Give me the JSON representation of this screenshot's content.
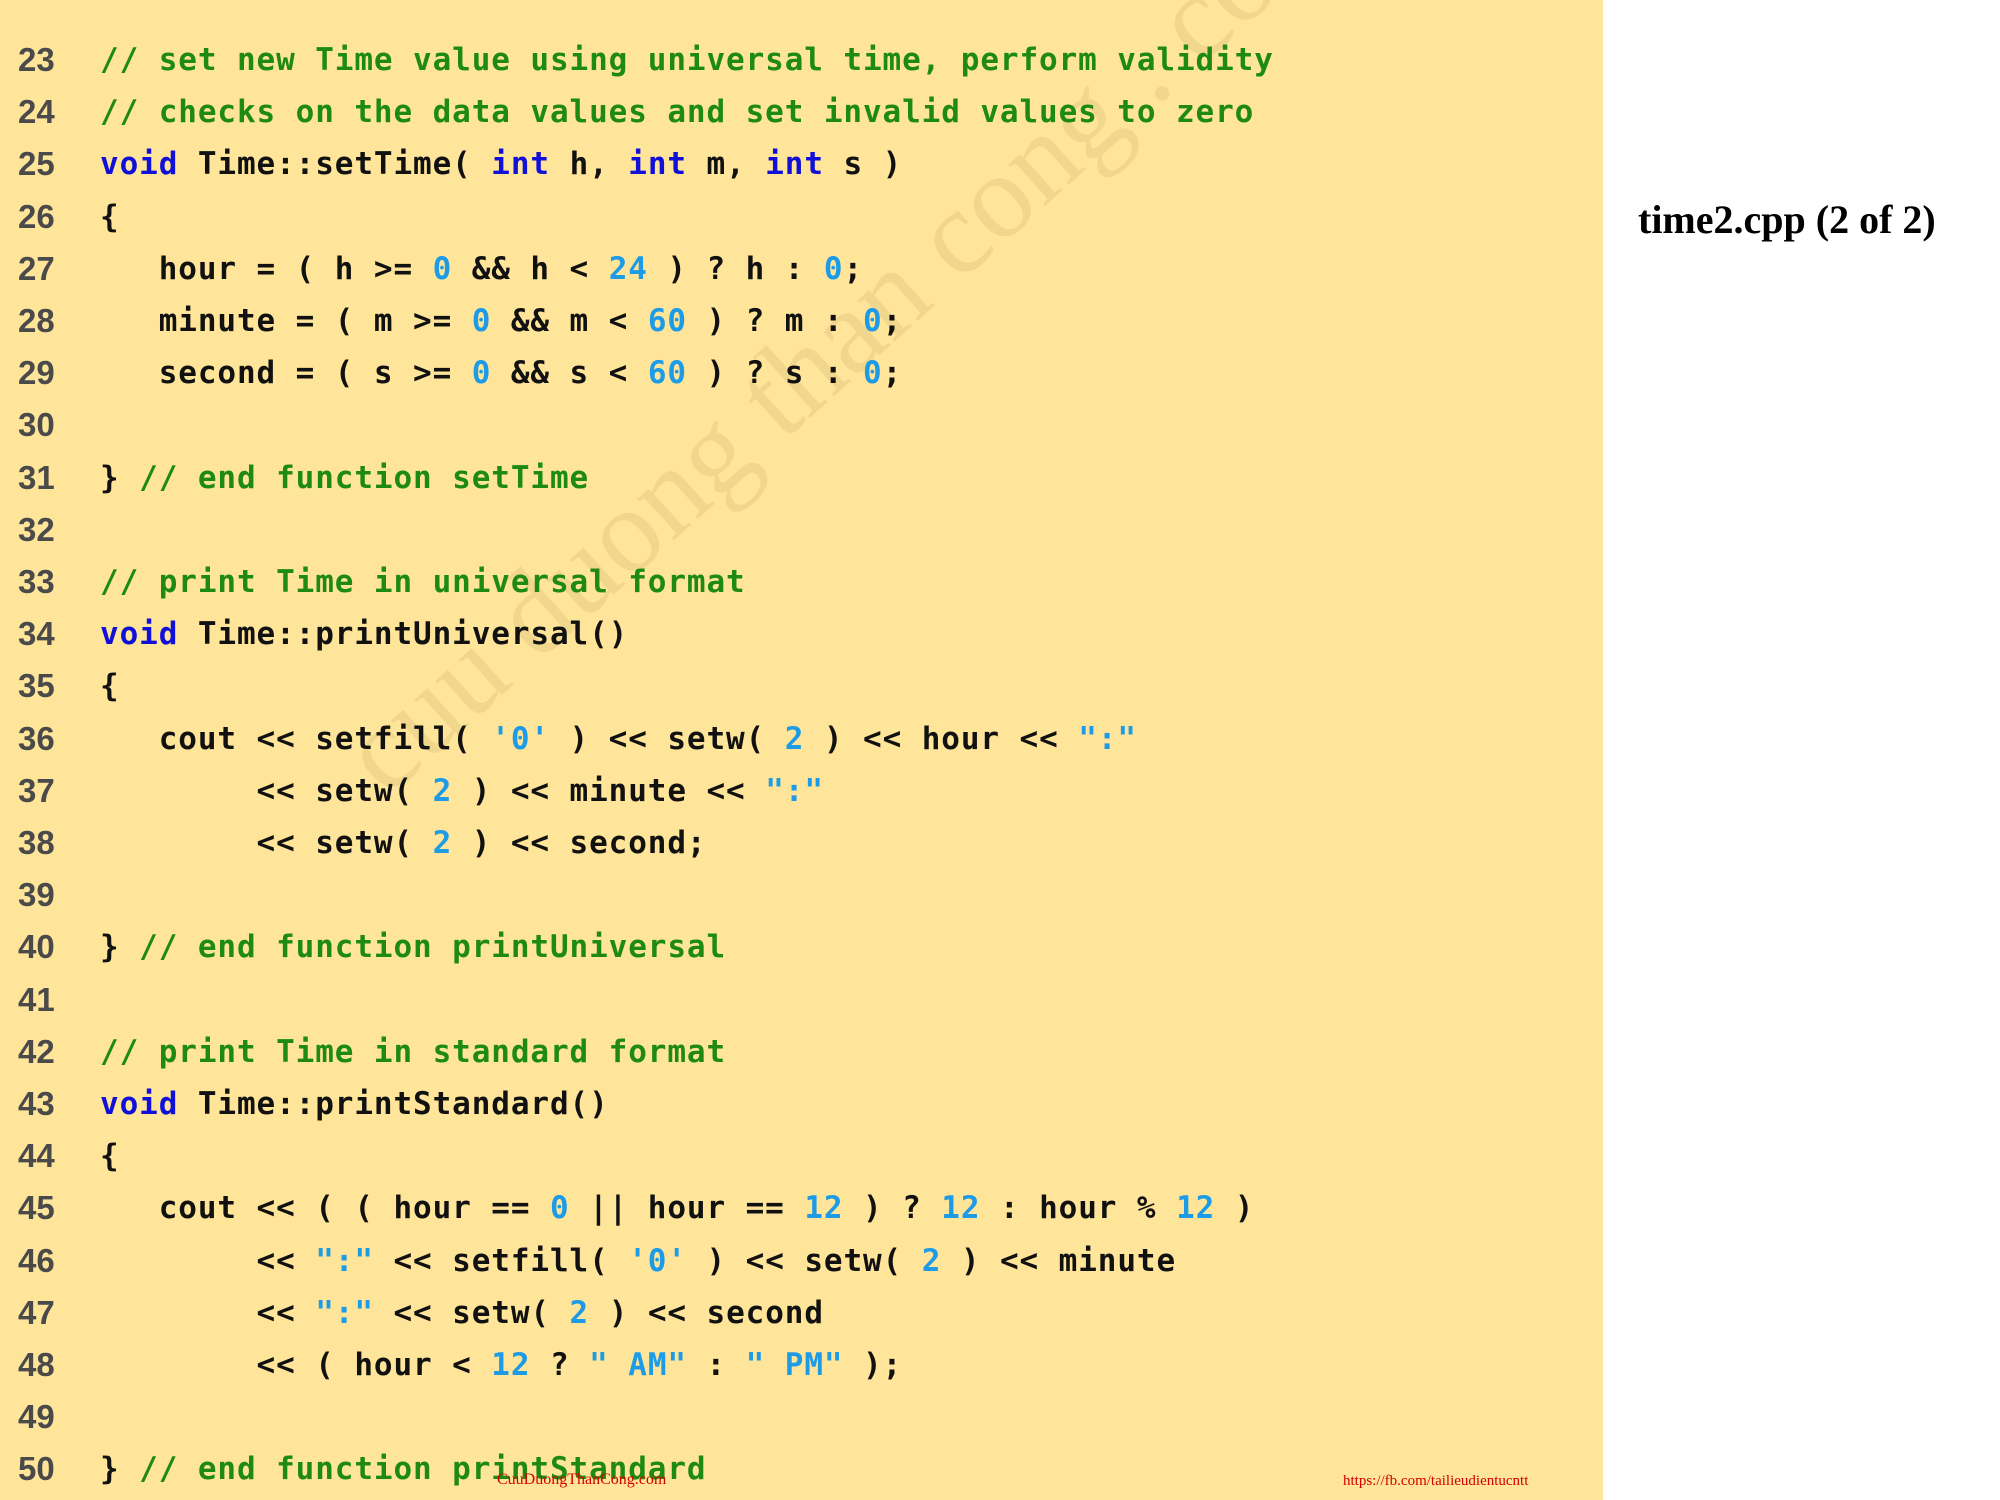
{
  "title": "time2.cpp (2 of 2)",
  "watermark": "cuu duong than cong . com",
  "footer": {
    "left": "CuuDuongThanCong.com",
    "right": "https://fb.com/tailieudientucntt"
  },
  "colors": {
    "panel_background": "#ffe599",
    "comment": "#1e8a14",
    "keyword": "#1010d8",
    "literal": "#1e9be6",
    "plain": "#111111",
    "line_number": "#4a4a4a"
  },
  "code_lines": [
    {
      "num": "23",
      "tokens": [
        {
          "t": "// set new Time value using universal time, perform validity",
          "c": "comment"
        }
      ]
    },
    {
      "num": "24",
      "tokens": [
        {
          "t": "// checks on the data values and set invalid values to zero",
          "c": "comment"
        }
      ]
    },
    {
      "num": "25",
      "tokens": [
        {
          "t": "void",
          "c": "keyword"
        },
        {
          "t": " Time::setTime( ",
          "c": "plain"
        },
        {
          "t": "int",
          "c": "keyword"
        },
        {
          "t": " h, ",
          "c": "plain"
        },
        {
          "t": "int",
          "c": "keyword"
        },
        {
          "t": " m, ",
          "c": "plain"
        },
        {
          "t": "int",
          "c": "keyword"
        },
        {
          "t": " s )",
          "c": "plain"
        }
      ]
    },
    {
      "num": "26",
      "tokens": [
        {
          "t": "{",
          "c": "plain"
        }
      ]
    },
    {
      "num": "27",
      "tokens": [
        {
          "t": "   hour = ( h >= ",
          "c": "plain"
        },
        {
          "t": "0",
          "c": "literal"
        },
        {
          "t": " && h < ",
          "c": "plain"
        },
        {
          "t": "24",
          "c": "literal"
        },
        {
          "t": " ) ? h : ",
          "c": "plain"
        },
        {
          "t": "0",
          "c": "literal"
        },
        {
          "t": ";",
          "c": "plain"
        }
      ]
    },
    {
      "num": "28",
      "tokens": [
        {
          "t": "   minute = ( m >= ",
          "c": "plain"
        },
        {
          "t": "0",
          "c": "literal"
        },
        {
          "t": " && m < ",
          "c": "plain"
        },
        {
          "t": "60",
          "c": "literal"
        },
        {
          "t": " ) ? m : ",
          "c": "plain"
        },
        {
          "t": "0",
          "c": "literal"
        },
        {
          "t": ";",
          "c": "plain"
        }
      ]
    },
    {
      "num": "29",
      "tokens": [
        {
          "t": "   second = ( s >= ",
          "c": "plain"
        },
        {
          "t": "0",
          "c": "literal"
        },
        {
          "t": " && s < ",
          "c": "plain"
        },
        {
          "t": "60",
          "c": "literal"
        },
        {
          "t": " ) ? s : ",
          "c": "plain"
        },
        {
          "t": "0",
          "c": "literal"
        },
        {
          "t": ";",
          "c": "plain"
        }
      ]
    },
    {
      "num": "30",
      "tokens": []
    },
    {
      "num": "31",
      "tokens": [
        {
          "t": "} ",
          "c": "plain"
        },
        {
          "t": "// end function setTime",
          "c": "comment"
        }
      ]
    },
    {
      "num": "32",
      "tokens": []
    },
    {
      "num": "33",
      "tokens": [
        {
          "t": "// print Time in universal format",
          "c": "comment"
        }
      ]
    },
    {
      "num": "34",
      "tokens": [
        {
          "t": "void",
          "c": "keyword"
        },
        {
          "t": " Time::printUniversal()",
          "c": "plain"
        }
      ]
    },
    {
      "num": "35",
      "tokens": [
        {
          "t": "{",
          "c": "plain"
        }
      ]
    },
    {
      "num": "36",
      "tokens": [
        {
          "t": "   cout << setfill( ",
          "c": "plain"
        },
        {
          "t": "'0'",
          "c": "literal"
        },
        {
          "t": " ) << setw( ",
          "c": "plain"
        },
        {
          "t": "2",
          "c": "literal"
        },
        {
          "t": " ) << hour << ",
          "c": "plain"
        },
        {
          "t": "\":\"",
          "c": "literal"
        }
      ]
    },
    {
      "num": "37",
      "tokens": [
        {
          "t": "        << setw( ",
          "c": "plain"
        },
        {
          "t": "2",
          "c": "literal"
        },
        {
          "t": " ) << minute << ",
          "c": "plain"
        },
        {
          "t": "\":\"",
          "c": "literal"
        }
      ]
    },
    {
      "num": "38",
      "tokens": [
        {
          "t": "        << setw( ",
          "c": "plain"
        },
        {
          "t": "2",
          "c": "literal"
        },
        {
          "t": " ) << second;",
          "c": "plain"
        }
      ]
    },
    {
      "num": "39",
      "tokens": []
    },
    {
      "num": "40",
      "tokens": [
        {
          "t": "} ",
          "c": "plain"
        },
        {
          "t": "// end function printUniversal",
          "c": "comment"
        }
      ]
    },
    {
      "num": "41",
      "tokens": []
    },
    {
      "num": "42",
      "tokens": [
        {
          "t": "// print Time in standard format",
          "c": "comment"
        }
      ]
    },
    {
      "num": "43",
      "tokens": [
        {
          "t": "void",
          "c": "keyword"
        },
        {
          "t": " Time::printStandard()",
          "c": "plain"
        }
      ]
    },
    {
      "num": "44",
      "tokens": [
        {
          "t": "{",
          "c": "plain"
        }
      ]
    },
    {
      "num": "45",
      "tokens": [
        {
          "t": "   cout << ( ( hour == ",
          "c": "plain"
        },
        {
          "t": "0",
          "c": "literal"
        },
        {
          "t": " || hour == ",
          "c": "plain"
        },
        {
          "t": "12",
          "c": "literal"
        },
        {
          "t": " ) ? ",
          "c": "plain"
        },
        {
          "t": "12",
          "c": "literal"
        },
        {
          "t": " : hour % ",
          "c": "plain"
        },
        {
          "t": "12",
          "c": "literal"
        },
        {
          "t": " )",
          "c": "plain"
        }
      ]
    },
    {
      "num": "46",
      "tokens": [
        {
          "t": "        << ",
          "c": "plain"
        },
        {
          "t": "\":\"",
          "c": "literal"
        },
        {
          "t": " << setfill( ",
          "c": "plain"
        },
        {
          "t": "'0'",
          "c": "literal"
        },
        {
          "t": " ) << setw( ",
          "c": "plain"
        },
        {
          "t": "2",
          "c": "literal"
        },
        {
          "t": " ) << minute",
          "c": "plain"
        }
      ]
    },
    {
      "num": "47",
      "tokens": [
        {
          "t": "        << ",
          "c": "plain"
        },
        {
          "t": "\":\"",
          "c": "literal"
        },
        {
          "t": " << setw( ",
          "c": "plain"
        },
        {
          "t": "2",
          "c": "literal"
        },
        {
          "t": " ) << second",
          "c": "plain"
        }
      ]
    },
    {
      "num": "48",
      "tokens": [
        {
          "t": "        << ( hour < ",
          "c": "plain"
        },
        {
          "t": "12",
          "c": "literal"
        },
        {
          "t": " ? ",
          "c": "plain"
        },
        {
          "t": "\" AM\"",
          "c": "literal"
        },
        {
          "t": " : ",
          "c": "plain"
        },
        {
          "t": "\" PM\"",
          "c": "literal"
        },
        {
          "t": " );",
          "c": "plain"
        }
      ]
    },
    {
      "num": "49",
      "tokens": []
    },
    {
      "num": "50",
      "tokens": [
        {
          "t": "} ",
          "c": "plain"
        },
        {
          "t": "// end function printStandard",
          "c": "comment"
        }
      ]
    }
  ]
}
